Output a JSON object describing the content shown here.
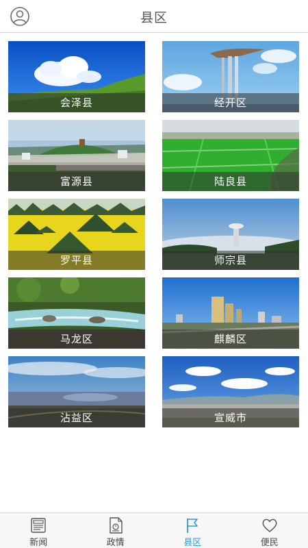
{
  "header": {
    "title": "县区",
    "avatar_icon": "user-circle-icon"
  },
  "districts": [
    {
      "name": "会泽县",
      "scene": "sky-meadow"
    },
    {
      "name": "经开区",
      "scene": "sculpture-sky"
    },
    {
      "name": "富源县",
      "scene": "town-bridge"
    },
    {
      "name": "陆良县",
      "scene": "green-plain"
    },
    {
      "name": "罗平县",
      "scene": "rapeseed-peaks"
    },
    {
      "name": "师宗县",
      "scene": "tower-fog"
    },
    {
      "name": "马龙区",
      "scene": "forest-stream"
    },
    {
      "name": "麒麟区",
      "scene": "city-skyline"
    },
    {
      "name": "沾益区",
      "scene": "lake-dusk"
    },
    {
      "name": "宣威市",
      "scene": "city-plain"
    }
  ],
  "nav": {
    "active": "县区",
    "items": [
      {
        "label": "新闻",
        "icon": "newspaper-icon"
      },
      {
        "label": "政情",
        "icon": "document-icon"
      },
      {
        "label": "县区",
        "icon": "flag-icon"
      },
      {
        "label": "便民",
        "icon": "heart-icon"
      }
    ]
  },
  "colors": {
    "accent": "#2a9bd8",
    "caption_bg": "rgba(50,50,50,0.55)",
    "header_text": "#555555"
  }
}
